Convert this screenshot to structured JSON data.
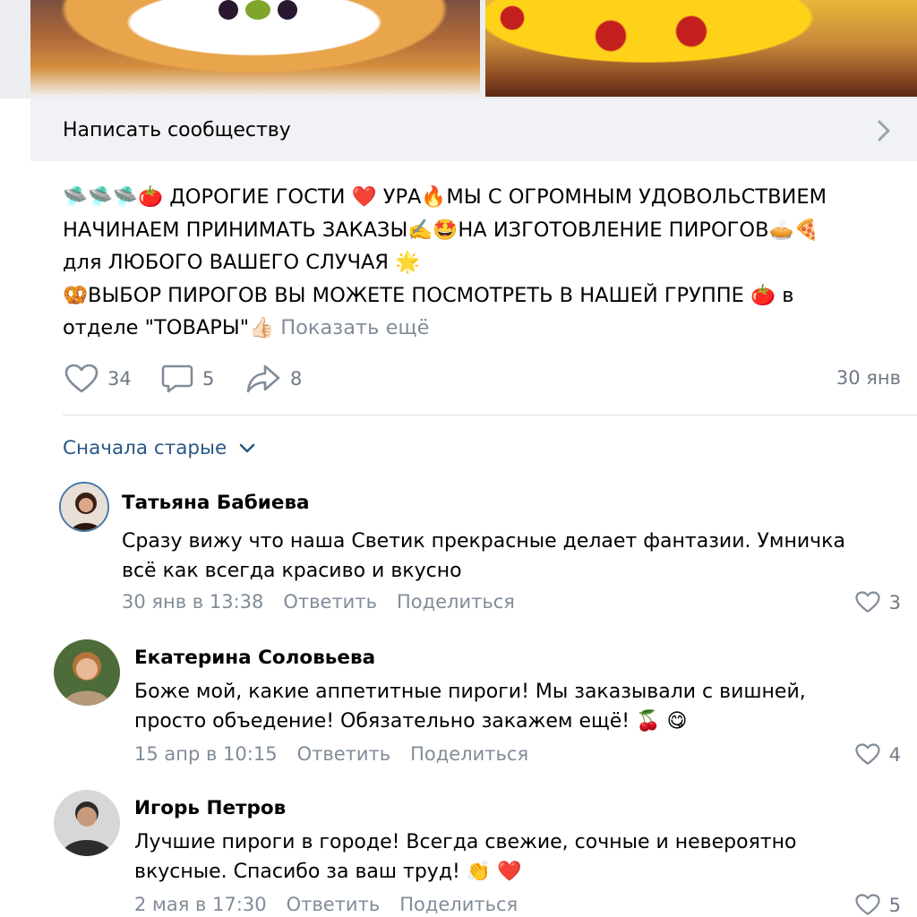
{
  "write_bar": {
    "label": "Написать сообществу"
  },
  "post": {
    "lines": [
      "🛸🛸🛸🍅 ДОРОГИЕ ГОСТИ ❤️ УРА🔥МЫ С ОГРОМНЫМ УДОВОЛЬСТВИЕМ",
      "НАЧИНАЕМ ПРИНИМАТЬ ЗАКАЗЫ✍️🤩НА ИЗГОТОВЛЕНИЕ ПИРОГОВ🥧🍕",
      "для ЛЮБОГО ВАШЕГО СЛУЧАЯ 🌟",
      "🥨ВЫБОР ПИРОГОВ ВЫ МОЖЕТЕ ПОСМОТРЕТЬ В НАШЕЙ ГРУППЕ 🍅 в"
    ],
    "last_line": "отделе \"ТОВАРЫ\"👍🏻",
    "show_more": "Показать ещё",
    "likes": "34",
    "comments": "5",
    "shares": "8",
    "date": "30 янв"
  },
  "sort": {
    "label": "Сначала старые"
  },
  "comments": [
    {
      "name": "Татьяна Бабиева",
      "text_lines": [
        "Сразу вижу что наша Светик прекрасные делает фантазии. Умничка",
        "всё как всегда красиво и вкусно"
      ],
      "time": "30 янв в 13:38",
      "reply": "Ответить",
      "share": "Поделиться",
      "likes": "3"
    },
    {
      "name": "Екатерина Соловьева",
      "text_lines": [
        "Боже мой, какие аппетитные пироги! Мы заказывали с вишней,",
        "просто объедение!  Обязательно закажем ещё! 🍒 😋"
      ],
      "time": "15 апр в 10:15",
      "reply": "Ответить",
      "share": "Поделиться",
      "likes": "4"
    },
    {
      "name": "Игорь Петров",
      "text_lines": [
        "Лучшие пироги в городе! Всегда свежие, сочные и невероятно",
        "вкусные. Спасибо за ваш труд! 👏 ❤️"
      ],
      "time": "2 мая в 17:30",
      "reply": "Ответить",
      "share": "Поделиться",
      "likes": "5"
    }
  ],
  "colors": {
    "accent": "#2a5885",
    "muted": "#818c99",
    "icon": "#6f7985",
    "bar": "#f0f2f5"
  },
  "icons": [
    "chevron-right-icon",
    "heart-icon",
    "comment-icon",
    "share-icon",
    "chevron-down-icon"
  ]
}
